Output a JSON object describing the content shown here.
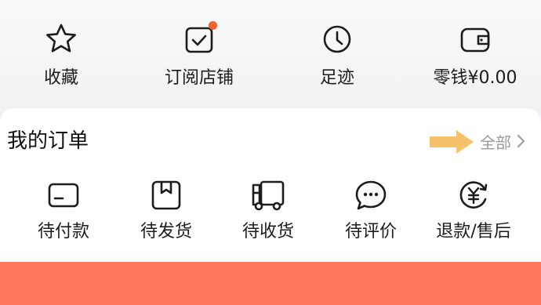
{
  "quick_actions": [
    {
      "label": "收藏",
      "icon": "star-icon"
    },
    {
      "label": "订阅店铺",
      "icon": "subscribe-store-icon"
    },
    {
      "label": "足迹",
      "icon": "clock-icon"
    },
    {
      "label": "零钱¥0.00",
      "icon": "wallet-icon"
    }
  ],
  "orders": {
    "title": "我的订单",
    "all_label": "全部",
    "items": [
      {
        "label": "待付款",
        "icon": "card-icon"
      },
      {
        "label": "待发货",
        "icon": "package-icon"
      },
      {
        "label": "待收货",
        "icon": "truck-icon"
      },
      {
        "label": "待评价",
        "icon": "chat-bubble-icon"
      },
      {
        "label": "退款/售后",
        "icon": "refund-icon"
      }
    ]
  },
  "colors": {
    "notification_dot": "#f0622a",
    "arrow": "#f5c26b",
    "bottom_bar": "#ff7a5c",
    "icon_stroke": "#1c1c1e"
  }
}
